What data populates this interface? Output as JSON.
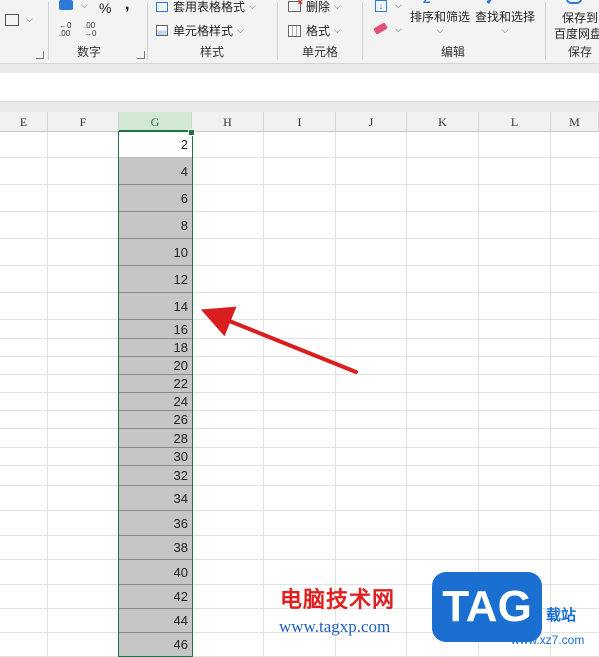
{
  "ribbon": {
    "number_group": {
      "percent_symbol": "%",
      "comma_symbol": ",",
      "label": "数字"
    },
    "styles_group": {
      "table_format": "套用表格格式",
      "cell_style": "单元格样式",
      "label": "样式"
    },
    "cells_group": {
      "delete": "删除",
      "format": "格式",
      "label": "单元格"
    },
    "edit_group": {
      "sort_filter": "排序和筛选",
      "find_select": "查找和选择",
      "label": "编辑",
      "z_glyph": "Z"
    },
    "save_group": {
      "line1": "保存到",
      "line2": "百度网盘",
      "label": "保存"
    }
  },
  "sheet": {
    "columns": [
      "E",
      "F",
      "G",
      "H",
      "I",
      "J",
      "K",
      "L",
      "M"
    ],
    "selected_column": "G",
    "values": [
      "2",
      "4",
      "6",
      "8",
      "10",
      "12",
      "14",
      "16",
      "18",
      "20",
      "22",
      "24",
      "26",
      "28",
      "30",
      "32",
      "34",
      "36",
      "38",
      "40",
      "42",
      "44",
      "46"
    ]
  },
  "watermark": {
    "site_cn": "电脑技术网",
    "url": "www.tagxp.com",
    "logo": "TAG",
    "side_text": "载站",
    "side_url": "www.xz7.com"
  },
  "colors": {
    "selection_border": "#217346",
    "filled_cell": "#c6c6c6",
    "arrow": "#d81e1e"
  }
}
